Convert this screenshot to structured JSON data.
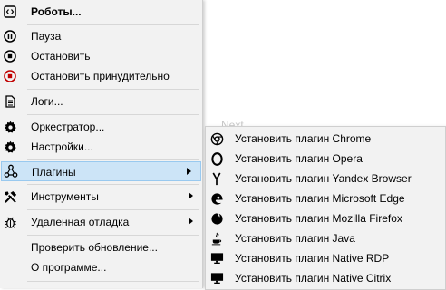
{
  "background": {
    "text": "Next"
  },
  "menu": {
    "items": [
      {
        "label": "Роботы...",
        "icon": "code-box-icon"
      },
      {
        "label": "Пауза",
        "icon": "pause-icon"
      },
      {
        "label": "Остановить",
        "icon": "stop-icon"
      },
      {
        "label": "Остановить принудительно",
        "icon": "force-stop-icon"
      },
      {
        "label": "Логи...",
        "icon": "document-icon"
      },
      {
        "label": "Оркестратор...",
        "icon": "gear-icon"
      },
      {
        "label": "Настройки...",
        "icon": "gear-icon"
      },
      {
        "label": "Плагины",
        "icon": "plugin-nodes-icon",
        "highlighted": true
      },
      {
        "label": "Инструменты",
        "icon": "tools-icon"
      },
      {
        "label": "Удаленная отладка",
        "icon": "bug-icon"
      },
      {
        "label": "Проверить обновление...",
        "icon": ""
      },
      {
        "label": "О программе...",
        "icon": ""
      }
    ]
  },
  "submenu": {
    "items": [
      {
        "label": "Установить плагин Chrome",
        "icon": "chrome-icon"
      },
      {
        "label": "Установить плагин Opera",
        "icon": "opera-icon"
      },
      {
        "label": "Установить плагин Yandex Browser",
        "icon": "yandex-icon"
      },
      {
        "label": "Установить плагин Microsoft Edge",
        "icon": "edge-icon"
      },
      {
        "label": "Установить плагин Mozilla Firefox",
        "icon": "firefox-icon"
      },
      {
        "label": "Установить плагин Java",
        "icon": "java-icon"
      },
      {
        "label": "Установить плагин Native RDP",
        "icon": "monitor-icon"
      },
      {
        "label": "Установить плагин Native Citrix",
        "icon": "monitor-icon"
      }
    ]
  },
  "colors": {
    "highlight": "#cce4f7",
    "highlight_border": "#99c9ef",
    "menu_bg": "#f2f2f2",
    "force_stop": "#c00000"
  }
}
